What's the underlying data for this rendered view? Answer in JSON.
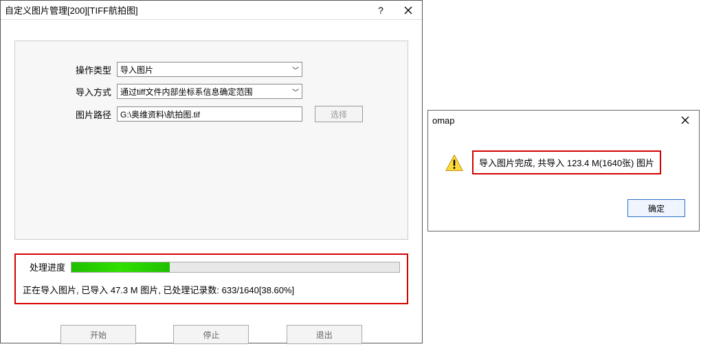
{
  "dialog1": {
    "title": "自定义图片管理[200][TIFF航拍图]",
    "form": {
      "op_type_label": "操作类型",
      "op_type_value": "导入图片",
      "import_mode_label": "导入方式",
      "import_mode_value": "通过tiff文件内部坐标系信息确定范围",
      "path_label": "图片路径",
      "path_value": "G:\\奥维资料\\航拍图.tif",
      "select_btn": "选择"
    },
    "progress": {
      "label": "处理进度",
      "percent": 30,
      "status": "正在导入图片, 已导入 47.3 M 图片, 已处理记录数: 633/1640[38.60%]"
    },
    "buttons": {
      "start": "开始",
      "stop": "停止",
      "exit": "退出"
    }
  },
  "dialog2": {
    "title": "omap",
    "message": "导入图片完成, 共导入 123.4 M(1640张) 图片",
    "ok": "确定"
  }
}
